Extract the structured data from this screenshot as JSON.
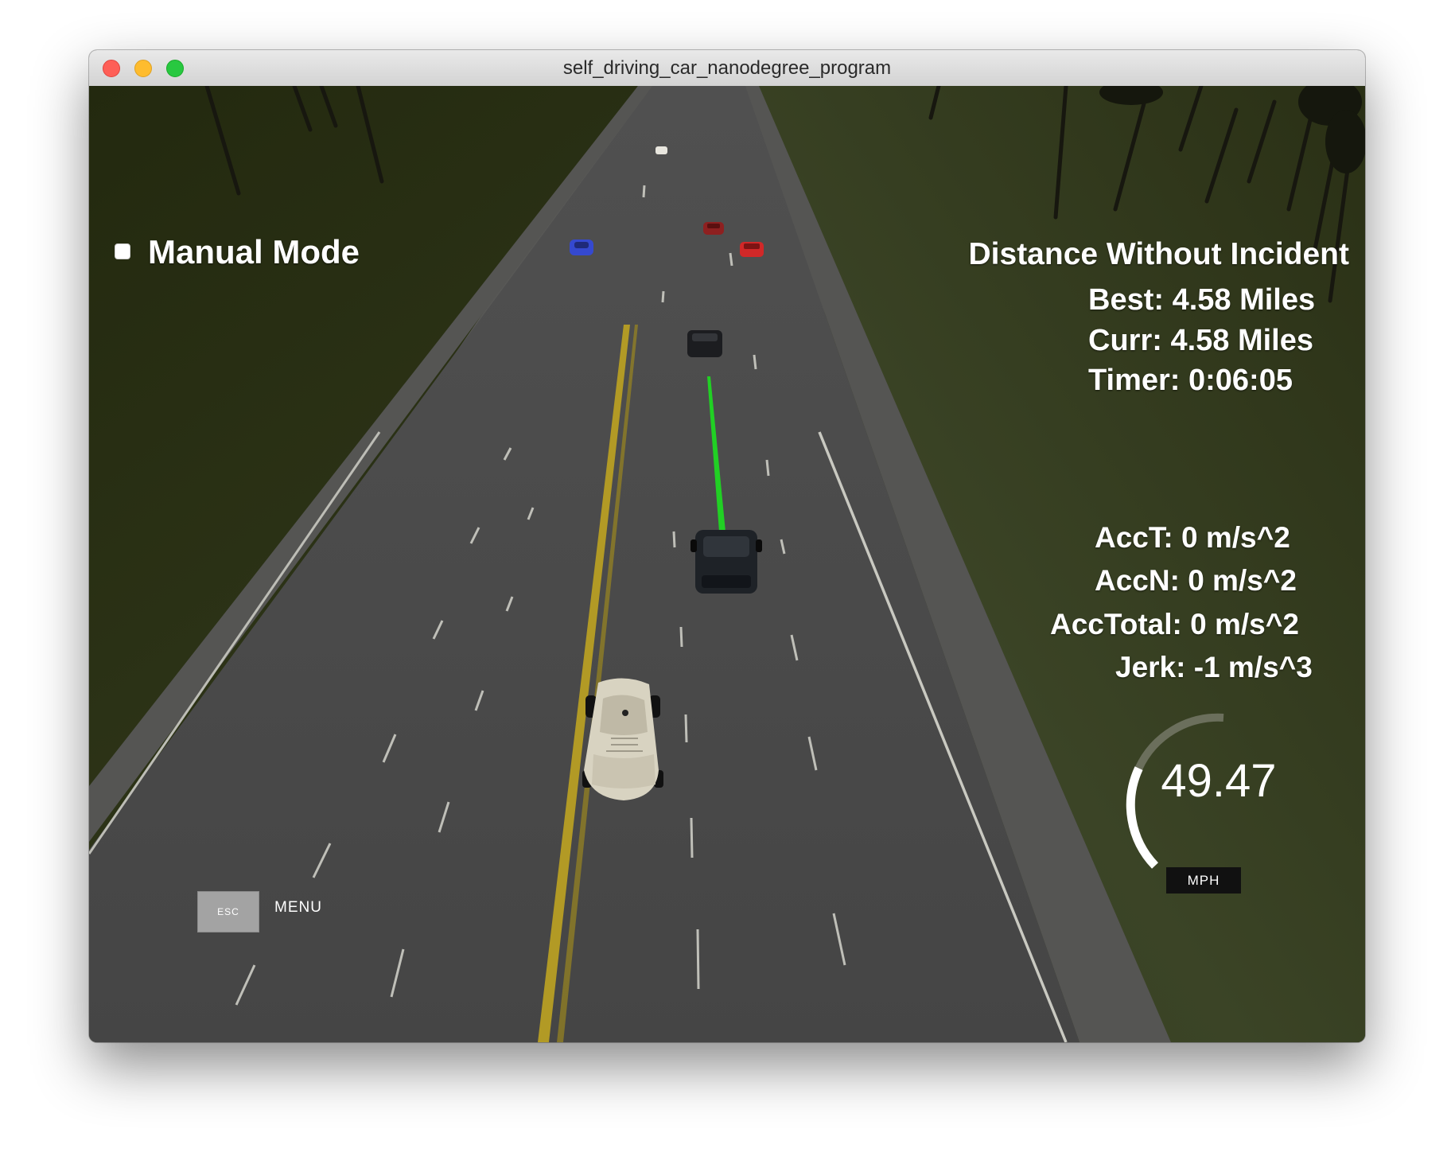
{
  "window": {
    "title": "self_driving_car_nanodegree_program"
  },
  "hud": {
    "manual_mode_label": "Manual Mode",
    "manual_mode_checked": false,
    "distance_title": "Distance Without Incident",
    "best": "Best: 4.58 Miles",
    "curr": "Curr: 4.58 Miles",
    "timer": "Timer: 0:06:05",
    "acc_t": "AccT: 0 m/s^2",
    "acc_n": "AccN: 0 m/s^2",
    "acc_total": "AccTotal: 0 m/s^2",
    "jerk": "Jerk: -1 m/s^3",
    "speed_value": "49.47",
    "speed_unit": "MPH",
    "speed_gauge_fraction": 0.5,
    "esc_key_label": "ESC",
    "menu_label": "MENU"
  },
  "colors": {
    "grass": "#2f3519",
    "road": "#4a4a48",
    "center_line": "#b8a22a",
    "planned_path": "#22dd22",
    "ego_car": "#d9d4c4",
    "car_blue": "#3a4fd8",
    "car_red": "#d02a2a",
    "car_dark_red": "#8a2020",
    "car_black": "#1d1f24"
  }
}
